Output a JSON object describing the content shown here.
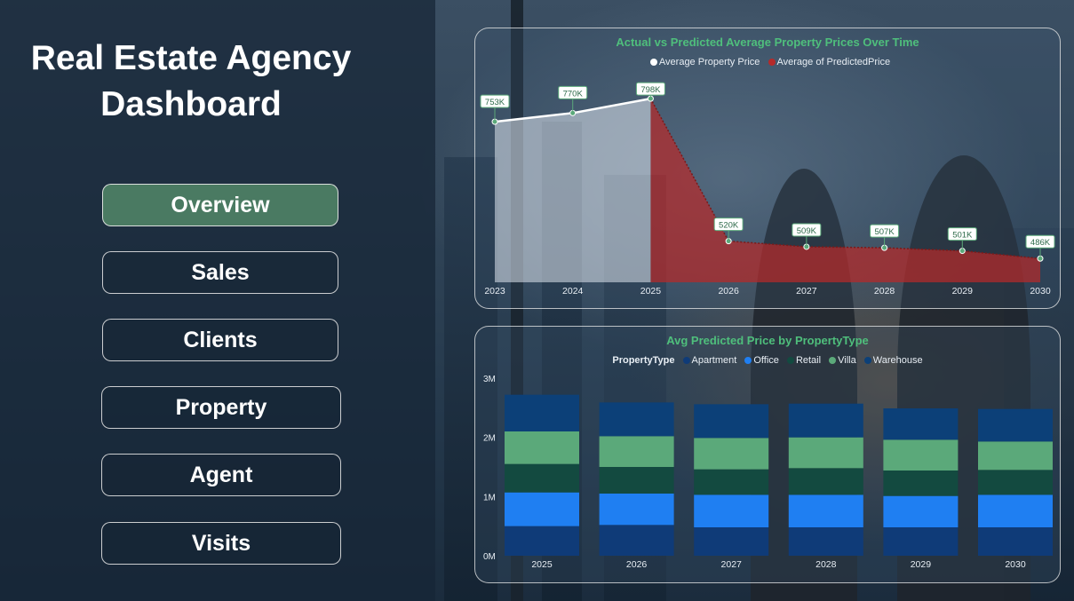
{
  "title_lines": [
    "Real Estate Agency",
    "Dashboard"
  ],
  "nav": [
    {
      "label": "Overview",
      "active": true
    },
    {
      "label": "Sales",
      "active": false
    },
    {
      "label": "Clients",
      "active": false
    },
    {
      "label": "Property",
      "active": false
    },
    {
      "label": "Agent",
      "active": false
    },
    {
      "label": "Visits",
      "active": false
    }
  ],
  "colors": {
    "accent_green": "#4fbf7c",
    "active_button": "#4a7a62",
    "actual_line": "#ffffff",
    "predicted_area": "#b52a2a",
    "apartment": "#0f3b78",
    "office": "#1f7ff2",
    "retail": "#134a40",
    "villa": "#5ba97a",
    "warehouse": "#0c4078"
  },
  "chart_data": [
    {
      "type": "area",
      "title": "Actual vs Predicted Average Property Prices Over Time",
      "legend": [
        "Average Property Price",
        "Average of PredictedPrice"
      ],
      "x": [
        "2023",
        "2024",
        "2025",
        "2026",
        "2027",
        "2028",
        "2029",
        "2030"
      ],
      "series": [
        {
          "name": "Average Property Price",
          "values": [
            753,
            770,
            798,
            null,
            null,
            null,
            null,
            null
          ]
        },
        {
          "name": "Average of PredictedPrice",
          "values": [
            null,
            null,
            798,
            520,
            509,
            507,
            501,
            486
          ]
        }
      ],
      "labels": [
        "753K",
        "770K",
        "798K",
        "520K",
        "509K",
        "507K",
        "501K",
        "486K"
      ],
      "unit": "K"
    },
    {
      "type": "bar",
      "stacked": true,
      "title": "Avg Predicted Price by PropertyType",
      "legend_title": "PropertyType",
      "legend": [
        "Apartment",
        "Office",
        "Retail",
        "Villa",
        "Warehouse"
      ],
      "categories": [
        "2025",
        "2026",
        "2027",
        "2028",
        "2029",
        "2030"
      ],
      "y_ticks": [
        "0M",
        "1M",
        "2M",
        "3M"
      ],
      "ylim": [
        0,
        3
      ],
      "series": [
        {
          "name": "Apartment",
          "values": [
            0.5,
            0.52,
            0.48,
            0.48,
            0.48,
            0.48
          ]
        },
        {
          "name": "Office",
          "values": [
            0.57,
            0.53,
            0.55,
            0.55,
            0.53,
            0.55
          ]
        },
        {
          "name": "Retail",
          "values": [
            0.48,
            0.45,
            0.43,
            0.45,
            0.43,
            0.42
          ]
        },
        {
          "name": "Villa",
          "values": [
            0.55,
            0.52,
            0.53,
            0.52,
            0.52,
            0.48
          ]
        },
        {
          "name": "Warehouse",
          "values": [
            0.62,
            0.57,
            0.57,
            0.57,
            0.53,
            0.55
          ]
        }
      ]
    }
  ]
}
